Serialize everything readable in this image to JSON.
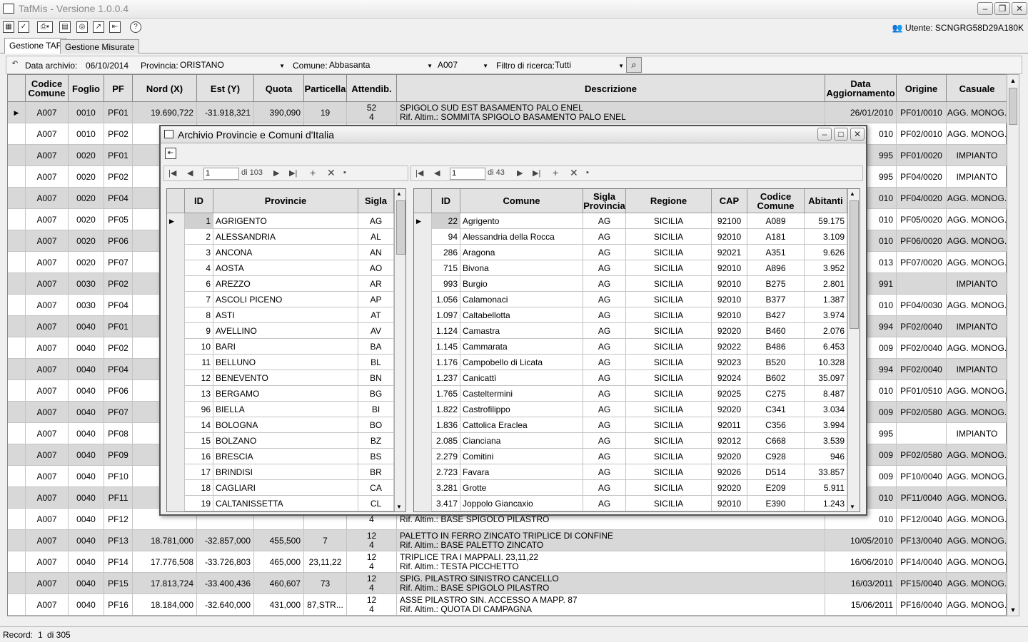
{
  "window": {
    "title": "TafMis - Versione 1.0.0.4"
  },
  "toolbar": {
    "user": "Utente: SCNGRG58D29A180K"
  },
  "tabs": [
    "Gestione TAF",
    "Gestione Misurate"
  ],
  "filters": {
    "data_label": "Data archivio:",
    "data_value": "06/10/2014",
    "provincia_label": "Provincia:",
    "provincia_value": "ORISTANO",
    "comune_label": "Comune:",
    "comune_value": "Abbasanta",
    "codice_value": "A007",
    "filtro_label": "Filtro di ricerca:",
    "filtro_value": "Tutti"
  },
  "grid": {
    "headers": [
      "Codice Comune",
      "Foglio",
      "PF",
      "Nord (X)",
      "Est (Y)",
      "Quota",
      "Particella",
      "Attendib.",
      "Descrizione",
      "Data Aggiornamento",
      "Origine",
      "Casuale"
    ],
    "rows": [
      {
        "cc": "A007",
        "fg": "0010",
        "pf": "PF01",
        "nord": "19.690,722",
        "est": "-31.918,321",
        "quota": "390,090",
        "part": "19",
        "att1": "52",
        "att2": "4",
        "d1": "SPIGOLO SUD EST BASAMENTO PALO ENEL",
        "d2": "Rif. Altim.: SOMMITA SPIGOLO BASAMENTO PALO ENEL",
        "data": "26/01/2010",
        "orig": "PF01/0010",
        "cas": "AGG. MONOG."
      },
      {
        "cc": "A007",
        "fg": "0010",
        "pf": "PF02",
        "nord": "",
        "est": "",
        "quota": "",
        "part": "",
        "att1": "",
        "att2": "",
        "d1": "",
        "d2": "",
        "data": "010",
        "orig": "PF02/0010",
        "cas": "AGG. MONOG."
      },
      {
        "cc": "A007",
        "fg": "0020",
        "pf": "PF01",
        "nord": "",
        "est": "",
        "quota": "",
        "part": "",
        "att1": "",
        "att2": "",
        "d1": "",
        "d2": "",
        "data": "995",
        "orig": "PF01/0020",
        "cas": "IMPIANTO"
      },
      {
        "cc": "A007",
        "fg": "0020",
        "pf": "PF02",
        "nord": "",
        "est": "",
        "quota": "",
        "part": "",
        "att1": "",
        "att2": "",
        "d1": "",
        "d2": "",
        "data": "995",
        "orig": "PF04/0020",
        "cas": "IMPIANTO"
      },
      {
        "cc": "A007",
        "fg": "0020",
        "pf": "PF04",
        "nord": "",
        "est": "",
        "quota": "",
        "part": "",
        "att1": "",
        "att2": "",
        "d1": "",
        "d2": "",
        "data": "010",
        "orig": "PF04/0020",
        "cas": "AGG. MONOG."
      },
      {
        "cc": "A007",
        "fg": "0020",
        "pf": "PF05",
        "nord": "",
        "est": "",
        "quota": "",
        "part": "",
        "att1": "",
        "att2": "",
        "d1": "",
        "d2": "",
        "data": "010",
        "orig": "PF05/0020",
        "cas": "AGG. MONOG."
      },
      {
        "cc": "A007",
        "fg": "0020",
        "pf": "PF06",
        "nord": "",
        "est": "",
        "quota": "",
        "part": "",
        "att1": "",
        "att2": "",
        "d1": "",
        "d2": "",
        "data": "010",
        "orig": "PF06/0020",
        "cas": "AGG. MONOG."
      },
      {
        "cc": "A007",
        "fg": "0020",
        "pf": "PF07",
        "nord": "",
        "est": "",
        "quota": "",
        "part": "",
        "att1": "",
        "att2": "",
        "d1": "",
        "d2": "",
        "data": "013",
        "orig": "PF07/0020",
        "cas": "AGG. MONOG."
      },
      {
        "cc": "A007",
        "fg": "0030",
        "pf": "PF02",
        "nord": "",
        "est": "",
        "quota": "",
        "part": "",
        "att1": "",
        "att2": "",
        "d1": "",
        "d2": "",
        "data": "991",
        "orig": "",
        "cas": "IMPIANTO"
      },
      {
        "cc": "A007",
        "fg": "0030",
        "pf": "PF04",
        "nord": "",
        "est": "",
        "quota": "",
        "part": "",
        "att1": "",
        "att2": "",
        "d1": "",
        "d2": "",
        "data": "010",
        "orig": "PF04/0030",
        "cas": "AGG. MONOG."
      },
      {
        "cc": "A007",
        "fg": "0040",
        "pf": "PF01",
        "nord": "",
        "est": "",
        "quota": "",
        "part": "",
        "att1": "",
        "att2": "",
        "d1": "",
        "d2": "",
        "data": "994",
        "orig": "PF02/0040",
        "cas": "IMPIANTO"
      },
      {
        "cc": "A007",
        "fg": "0040",
        "pf": "PF02",
        "nord": "",
        "est": "",
        "quota": "",
        "part": "",
        "att1": "",
        "att2": "",
        "d1": "",
        "d2": "",
        "data": "009",
        "orig": "PF02/0040",
        "cas": "AGG. MONOG."
      },
      {
        "cc": "A007",
        "fg": "0040",
        "pf": "PF04",
        "nord": "",
        "est": "",
        "quota": "",
        "part": "",
        "att1": "",
        "att2": "",
        "d1": "",
        "d2": "",
        "data": "994",
        "orig": "PF02/0040",
        "cas": "IMPIANTO"
      },
      {
        "cc": "A007",
        "fg": "0040",
        "pf": "PF06",
        "nord": "",
        "est": "",
        "quota": "",
        "part": "",
        "att1": "",
        "att2": "",
        "d1": "",
        "d2": "",
        "data": "010",
        "orig": "PF01/0510",
        "cas": "AGG. MONOG."
      },
      {
        "cc": "A007",
        "fg": "0040",
        "pf": "PF07",
        "nord": "",
        "est": "",
        "quota": "",
        "part": "",
        "att1": "",
        "att2": "",
        "d1": "",
        "d2": "",
        "data": "009",
        "orig": "PF02/0580",
        "cas": "AGG. MONOG."
      },
      {
        "cc": "A007",
        "fg": "0040",
        "pf": "PF08",
        "nord": "",
        "est": "",
        "quota": "",
        "part": "",
        "att1": "",
        "att2": "",
        "d1": "",
        "d2": "",
        "data": "995",
        "orig": "",
        "cas": "IMPIANTO"
      },
      {
        "cc": "A007",
        "fg": "0040",
        "pf": "PF09",
        "nord": "",
        "est": "",
        "quota": "",
        "part": "",
        "att1": "",
        "att2": "",
        "d1": "",
        "d2": "",
        "data": "009",
        "orig": "PF02/0580",
        "cas": "AGG. MONOG."
      },
      {
        "cc": "A007",
        "fg": "0040",
        "pf": "PF10",
        "nord": "",
        "est": "",
        "quota": "",
        "part": "",
        "att1": "",
        "att2": "",
        "d1": "",
        "d2": "",
        "data": "009",
        "orig": "PF10/0040",
        "cas": "AGG. MONOG."
      },
      {
        "cc": "A007",
        "fg": "0040",
        "pf": "PF11",
        "nord": "",
        "est": "",
        "quota": "",
        "part": "",
        "att1": "",
        "att2": "",
        "d1": "",
        "d2": "",
        "data": "010",
        "orig": "PF11/0040",
        "cas": "AGG. MONOG."
      },
      {
        "cc": "A007",
        "fg": "0040",
        "pf": "PF12",
        "nord": "",
        "est": "",
        "quota": "",
        "part": "",
        "att1": "",
        "att2": "4",
        "d1": "",
        "d2": "Rif. Altim.: BASE SPIGOLO PILASTRO",
        "data": "010",
        "orig": "PF12/0040",
        "cas": "AGG. MONOG."
      },
      {
        "cc": "A007",
        "fg": "0040",
        "pf": "PF13",
        "nord": "18.781,000",
        "est": "-32.857,000",
        "quota": "455,500",
        "part": "7",
        "att1": "12",
        "att2": "4",
        "d1": "PALETTO IN FERRO ZINCATO  TRIPLICE DI CONFINE",
        "d2": "Rif. Altim.: BASE PALETTO ZINCATO",
        "data": "10/05/2010",
        "orig": "PF13/0040",
        "cas": "AGG. MONOG."
      },
      {
        "cc": "A007",
        "fg": "0040",
        "pf": "PF14",
        "nord": "17.776,508",
        "est": "-33.726,803",
        "quota": "465,000",
        "part": "23,11,22",
        "att1": "12",
        "att2": "4",
        "d1": "TRIPLICE TRA I MAPPALI. 23,11,22",
        "d2": "Rif. Altim.: TESTA PICCHETTO",
        "data": "16/06/2010",
        "orig": "PF14/0040",
        "cas": "AGG. MONOG."
      },
      {
        "cc": "A007",
        "fg": "0040",
        "pf": "PF15",
        "nord": "17.813,724",
        "est": "-33.400,436",
        "quota": "460,607",
        "part": "73",
        "att1": "12",
        "att2": "4",
        "d1": "SPIG. PILASTRO SINISTRO CANCELLO",
        "d2": "Rif. Altim.: BASE SPIGOLO PILASTRO",
        "data": "16/03/2011",
        "orig": "PF15/0040",
        "cas": "AGG. MONOG."
      },
      {
        "cc": "A007",
        "fg": "0040",
        "pf": "PF16",
        "nord": "18.184,000",
        "est": "-32.640,000",
        "quota": "431,000",
        "part": "87,STR...",
        "att1": "12",
        "att2": "4",
        "d1": "ASSE PILASTRO SIN. ACCESSO A MAPP. 87",
        "d2": "Rif. Altim.: QUOTA DI CAMPAGNA",
        "data": "15/06/2011",
        "orig": "PF16/0040",
        "cas": "AGG. MONOG."
      }
    ]
  },
  "status": {
    "label": "Record:",
    "value": "1",
    "of": "di 305"
  },
  "dialog": {
    "title": "Archivio Provincie e Comuni d'Italia",
    "left_pager": {
      "value": "1",
      "of": "di 103"
    },
    "right_pager": {
      "value": "1",
      "of": "di 43"
    },
    "prov_headers": [
      "ID",
      "Provincie",
      "Sigla"
    ],
    "provincie": [
      [
        "1",
        "AGRIGENTO",
        "AG"
      ],
      [
        "2",
        "ALESSANDRIA",
        "AL"
      ],
      [
        "3",
        "ANCONA",
        "AN"
      ],
      [
        "4",
        "AOSTA",
        "AO"
      ],
      [
        "6",
        "AREZZO",
        "AR"
      ],
      [
        "7",
        "ASCOLI PICENO",
        "AP"
      ],
      [
        "8",
        "ASTI",
        "AT"
      ],
      [
        "9",
        "AVELLINO",
        "AV"
      ],
      [
        "10",
        "BARI",
        "BA"
      ],
      [
        "11",
        "BELLUNO",
        "BL"
      ],
      [
        "12",
        "BENEVENTO",
        "BN"
      ],
      [
        "13",
        "BERGAMO",
        "BG"
      ],
      [
        "96",
        "BIELLA",
        "BI"
      ],
      [
        "14",
        "BOLOGNA",
        "BO"
      ],
      [
        "15",
        "BOLZANO",
        "BZ"
      ],
      [
        "16",
        "BRESCIA",
        "BS"
      ],
      [
        "17",
        "BRINDISI",
        "BR"
      ],
      [
        "18",
        "CAGLIARI",
        "CA"
      ],
      [
        "19",
        "CALTANISSETTA",
        "CL"
      ]
    ],
    "com_headers": [
      "ID",
      "Comune",
      "Sigla Provincia",
      "Regione",
      "CAP",
      "Codice Comune",
      "Abitanti"
    ],
    "comuni": [
      [
        "22",
        "Agrigento",
        "AG",
        "SICILIA",
        "92100",
        "A089",
        "59.175"
      ],
      [
        "94",
        "Alessandria della Rocca",
        "AG",
        "SICILIA",
        "92010",
        "A181",
        "3.109"
      ],
      [
        "286",
        "Aragona",
        "AG",
        "SICILIA",
        "92021",
        "A351",
        "9.626"
      ],
      [
        "715",
        "Bivona",
        "AG",
        "SICILIA",
        "92010",
        "A896",
        "3.952"
      ],
      [
        "993",
        "Burgio",
        "AG",
        "SICILIA",
        "92010",
        "B275",
        "2.801"
      ],
      [
        "1.056",
        "Calamonaci",
        "AG",
        "SICILIA",
        "92010",
        "B377",
        "1.387"
      ],
      [
        "1.097",
        "Caltabellotta",
        "AG",
        "SICILIA",
        "92010",
        "B427",
        "3.974"
      ],
      [
        "1.124",
        "Camastra",
        "AG",
        "SICILIA",
        "92020",
        "B460",
        "2.076"
      ],
      [
        "1.145",
        "Cammarata",
        "AG",
        "SICILIA",
        "92022",
        "B486",
        "6.453"
      ],
      [
        "1.176",
        "Campobello di Licata",
        "AG",
        "SICILIA",
        "92023",
        "B520",
        "10.328"
      ],
      [
        "1.237",
        "Canicattì",
        "AG",
        "SICILIA",
        "92024",
        "B602",
        "35.097"
      ],
      [
        "1.765",
        "Casteltermini",
        "AG",
        "SICILIA",
        "92025",
        "C275",
        "8.487"
      ],
      [
        "1.822",
        "Castrofilippo",
        "AG",
        "SICILIA",
        "92020",
        "C341",
        "3.034"
      ],
      [
        "1.836",
        "Cattolica Eraclea",
        "AG",
        "SICILIA",
        "92011",
        "C356",
        "3.994"
      ],
      [
        "2.085",
        "Cianciana",
        "AG",
        "SICILIA",
        "92012",
        "C668",
        "3.539"
      ],
      [
        "2.279",
        "Comitini",
        "AG",
        "SICILIA",
        "92020",
        "C928",
        "946"
      ],
      [
        "2.723",
        "Favara",
        "AG",
        "SICILIA",
        "92026",
        "D514",
        "33.857"
      ],
      [
        "3.281",
        "Grotte",
        "AG",
        "SICILIA",
        "92020",
        "E209",
        "5.911"
      ],
      [
        "3.417",
        "Joppolo Giancaxio",
        "AG",
        "SICILIA",
        "92010",
        "E390",
        "1.243"
      ]
    ]
  }
}
